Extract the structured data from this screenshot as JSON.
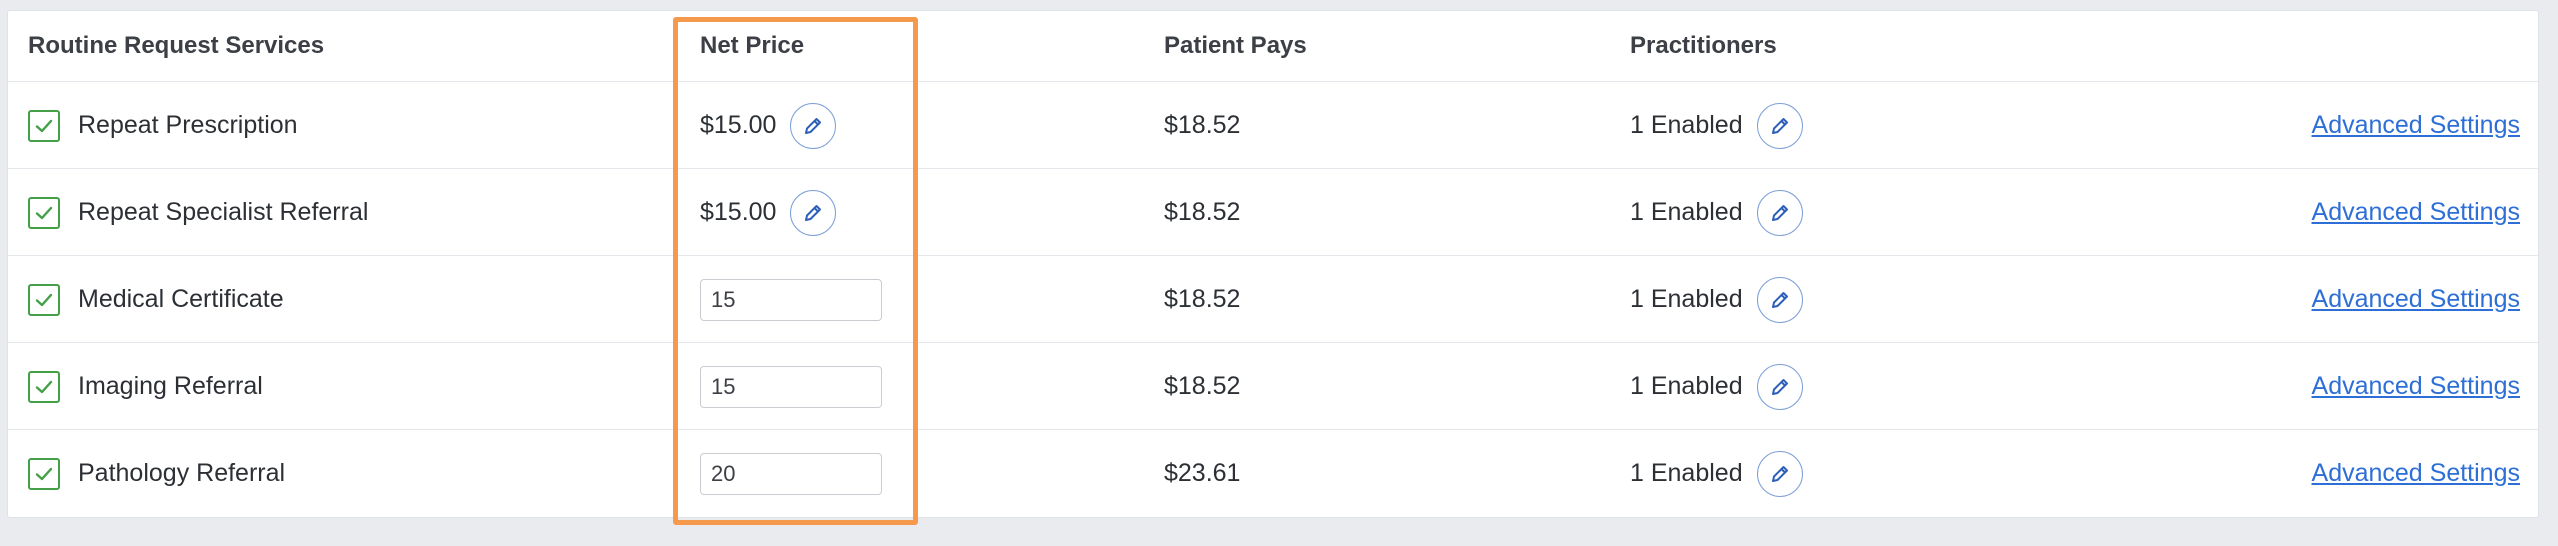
{
  "table": {
    "headers": {
      "service": "Routine Request Services",
      "net_price": "Net Price",
      "patient_pays": "Patient Pays",
      "practitioners": "Practitioners"
    },
    "rows": [
      {
        "service": "Repeat Prescription",
        "checked": true,
        "net_price_text": "$15.00",
        "net_price_input": null,
        "patient_pays": "$18.52",
        "practitioners": "1 Enabled",
        "advanced": "Advanced Settings"
      },
      {
        "service": "Repeat Specialist Referral",
        "checked": true,
        "net_price_text": "$15.00",
        "net_price_input": null,
        "patient_pays": "$18.52",
        "practitioners": "1 Enabled",
        "advanced": "Advanced Settings"
      },
      {
        "service": "Medical Certificate",
        "checked": true,
        "net_price_text": null,
        "net_price_input": "15",
        "patient_pays": "$18.52",
        "practitioners": "1 Enabled",
        "advanced": "Advanced Settings"
      },
      {
        "service": "Imaging Referral",
        "checked": true,
        "net_price_text": null,
        "net_price_input": "15",
        "patient_pays": "$18.52",
        "practitioners": "1 Enabled",
        "advanced": "Advanced Settings"
      },
      {
        "service": "Pathology Referral",
        "checked": true,
        "net_price_text": null,
        "net_price_input": "20",
        "patient_pays": "$23.61",
        "practitioners": "1 Enabled",
        "advanced": "Advanced Settings"
      }
    ]
  },
  "icons": {
    "checkbox": "check-icon",
    "edit": "pencil-icon"
  },
  "colors": {
    "checkbox": "#43a047",
    "edit_icon": "#2d5fb8",
    "link": "#2d6fd6",
    "highlight": "#f5994c"
  }
}
